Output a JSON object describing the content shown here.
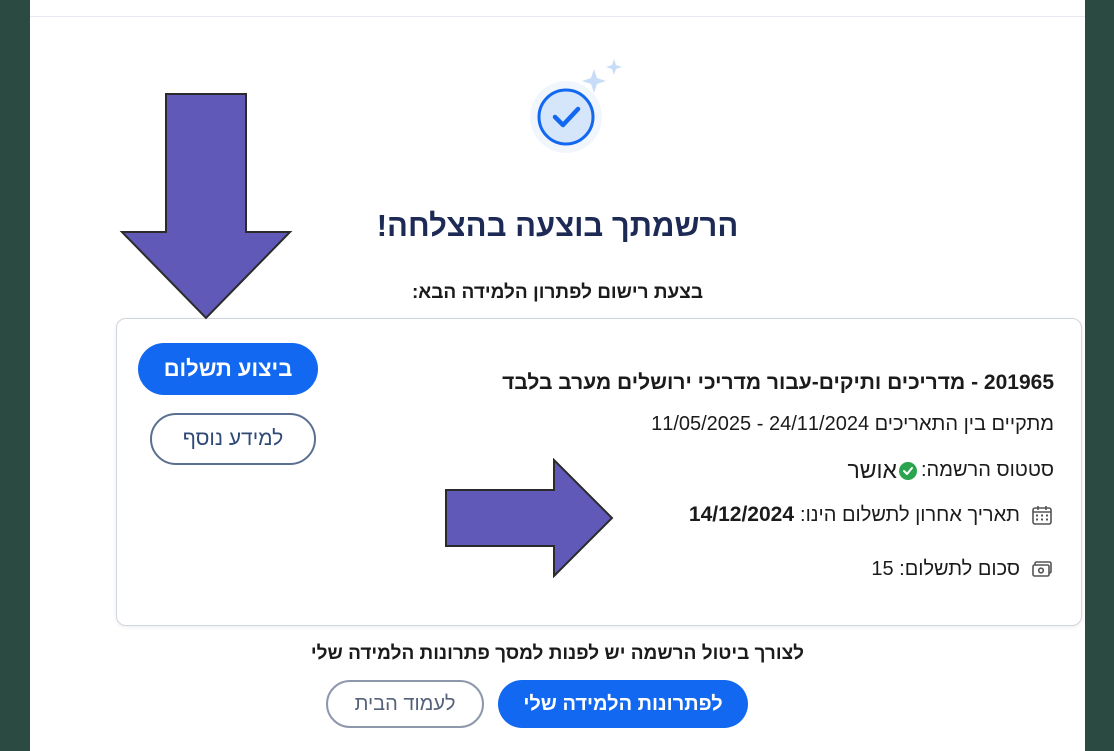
{
  "header": {
    "title": "הרשמתך בוצעה בהצלחה!",
    "subtitle": "בצעת רישום לפתרון הלמידה הבא:"
  },
  "registration": {
    "course": "201965 - מדריכים ותיקים-עבור מדריכי ירושלים מערב בלבד",
    "dates": "מתקיים בין התאריכים 24/11/2024 - 11/05/2025",
    "status_label": "סטטוס הרשמה:",
    "status_value": "אושר",
    "deadline_label": "תאריך אחרון לתשלום הינו:",
    "deadline_value": "14/12/2024",
    "amount_text": "סכום לתשלום: 15"
  },
  "buttons": {
    "pay": "ביצוע תשלום",
    "more_info": "למידע נוסף",
    "my_solutions": "לפתרונות הלמידה שלי",
    "home": "לעמוד הבית"
  },
  "footer": {
    "cancel_note": "לצורך ביטול הרשמה יש לפנות למסך פתרונות הלמידה שלי"
  },
  "colors": {
    "primary": "#1268f0",
    "success": "#2aa44f",
    "annotation_arrow": "#6059b8",
    "background": "#2b4a42"
  },
  "icons": {
    "success": "check-circle-icon",
    "sparkles": "sparkle-icon",
    "status": "check-badge-icon",
    "deadline": "calendar-icon",
    "amount": "cash-icon"
  }
}
